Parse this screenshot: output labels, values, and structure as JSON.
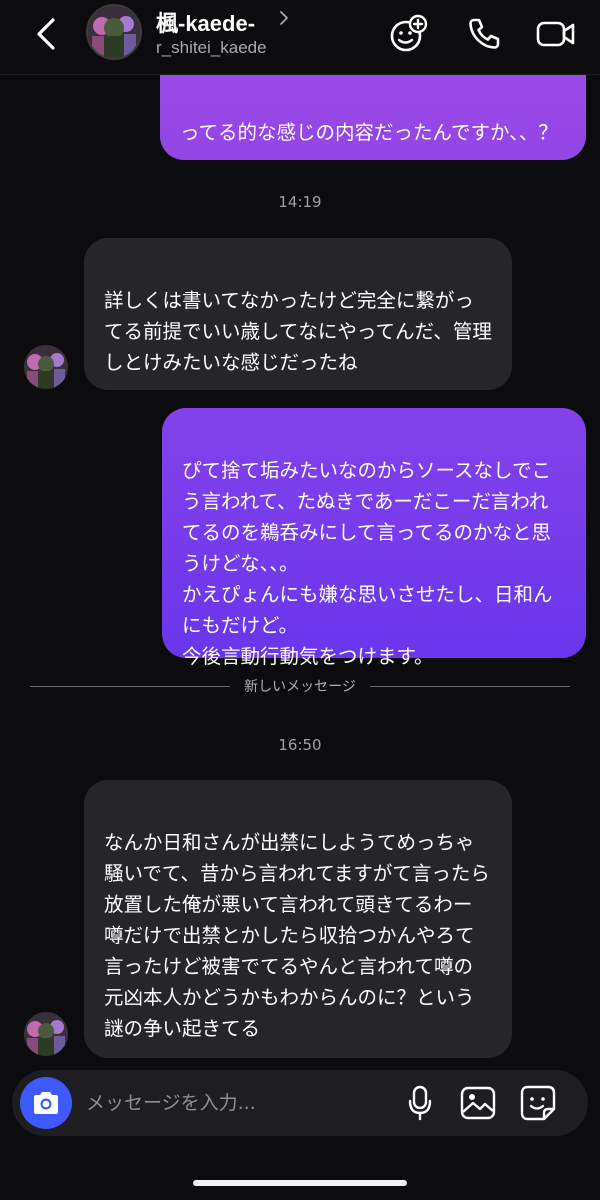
{
  "header": {
    "name": "楓-kaede-",
    "handle": "r_shitei_kaede",
    "icons": [
      "back-chevron-icon",
      "name-chevron-icon",
      "effects-icon",
      "phone-icon",
      "video-camera-icon"
    ]
  },
  "messages": [
    {
      "direction": "out",
      "text": "って繋がってるよね、、、的な感じの内容だったんですか、、？",
      "note": "partially cut off at top"
    },
    {
      "direction": "in",
      "text": "詳しくは書いてなかったけど完全に繋がってる前提でいい歳してなにやってんだ、管理しとけみたいな感じだったね"
    },
    {
      "direction": "out",
      "text": "ぴて捨て垢みたいなのからソースなしでこう言われて、たぬきであーだこーだ言われてるのを鵜呑みにして言ってるのかなと思うけどな、、。\nかえぴょんにも嫌な思いさせたし、日和んにもだけど。\n今後言動行動気をつけます。"
    },
    {
      "direction": "in",
      "text": "なんか日和さんが出禁にしようてめっちゃ騒いでて、昔から言われてますがて言ったら放置した俺が悪いて言われて頭きてるわー\n噂だけで出禁とかしたら収拾つかんやろて言ったけど被害でてるやんと言われて噂の元凶本人かどうかもわからんのに？という謎の争い起きてる"
    }
  ],
  "msg0_visible": "ってる的な感じの内容だったんですか、、？",
  "timestamps": [
    "14:19",
    "16:50"
  ],
  "divider": "新しいメッセージ",
  "composer": {
    "placeholder": "メッセージを入力...",
    "icons": [
      "camera-icon",
      "microphone-icon",
      "gallery-icon",
      "sticker-icon"
    ]
  },
  "colors": {
    "background": "#0c0c0f",
    "incoming_bubble": "#26262a",
    "outgoing_gradient_top": "#9b3fe0",
    "outgoing_gradient_bottom": "#6a35ec",
    "camera_button": "#3d5afe"
  }
}
